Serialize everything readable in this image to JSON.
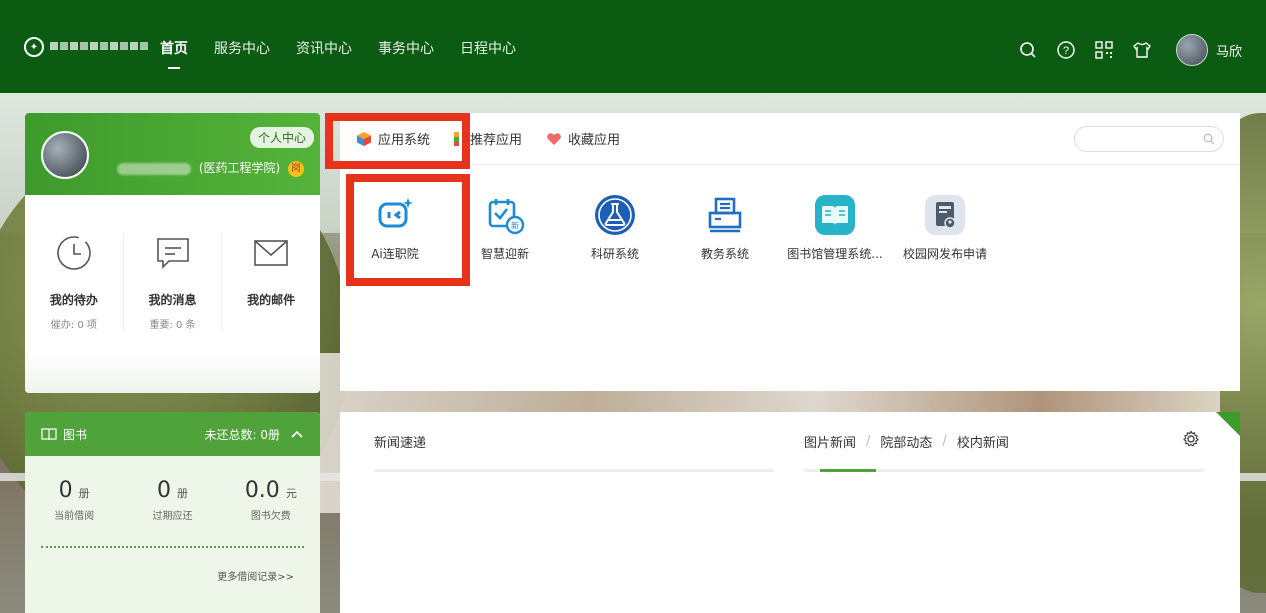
{
  "header": {
    "nav": [
      "首页",
      "服务中心",
      "资讯中心",
      "事务中心",
      "日程中心"
    ],
    "user_name": "马欣"
  },
  "profile": {
    "center_label": "个人中心",
    "college": "(医药工程学院)",
    "badge": "岗",
    "stats": [
      {
        "title": "我的待办",
        "sub": "催办: 0 项"
      },
      {
        "title": "我的消息",
        "sub": "重要: 0 条"
      },
      {
        "title": "我的邮件",
        "sub": ""
      }
    ]
  },
  "book": {
    "title": "图书",
    "unreturned": "未还总数: 0册",
    "numbers": [
      {
        "value": "0",
        "unit": "册",
        "label": "当前借阅"
      },
      {
        "value": "0",
        "unit": "册",
        "label": "过期应还"
      },
      {
        "value": "0.0",
        "unit": "元",
        "label": "图书欠费"
      }
    ],
    "more": "更多借阅记录>>"
  },
  "apps": {
    "tabs": [
      "应用系统",
      "推荐应用",
      "收藏应用"
    ],
    "items": [
      "Ai连职院",
      "智慧迎新",
      "科研系统",
      "教务系统",
      "图书馆管理系统...",
      "校园网发布申请"
    ]
  },
  "news": {
    "left_title": "新闻速递",
    "tabs": [
      "图片新闻",
      "院部动态",
      "校内新闻"
    ]
  }
}
